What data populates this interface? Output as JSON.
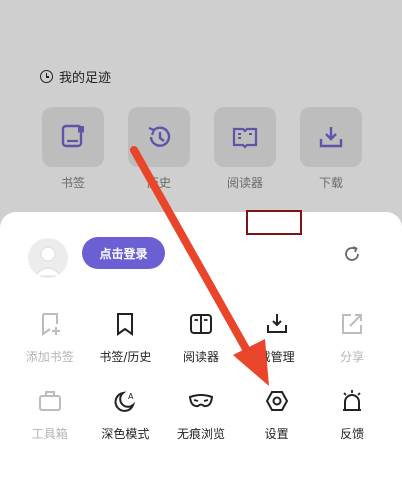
{
  "history_section": {
    "title": "我的足迹",
    "items": [
      {
        "label": "书签",
        "icon": "bookmark-book-icon"
      },
      {
        "label": "历史",
        "icon": "history-clock-icon"
      },
      {
        "label": "阅读器",
        "icon": "reader-book-icon"
      },
      {
        "label": "下载",
        "icon": "download-tray-icon"
      }
    ]
  },
  "sheet": {
    "login_label": "点击登录",
    "row1": [
      {
        "label": "添加书签",
        "icon": "add-bookmark-icon",
        "enabled": false
      },
      {
        "label": "书签/历史",
        "icon": "bookmark-icon",
        "enabled": true
      },
      {
        "label": "阅读器",
        "icon": "reader-icon",
        "enabled": true
      },
      {
        "label": "载管理",
        "icon": "download-manage-icon",
        "enabled": true
      },
      {
        "label": "分享",
        "icon": "share-icon",
        "enabled": false
      }
    ],
    "row2": [
      {
        "label": "工具箱",
        "icon": "toolbox-icon",
        "enabled": false
      },
      {
        "label": "深色模式",
        "icon": "dark-mode-icon",
        "enabled": true
      },
      {
        "label": "无痕浏览",
        "icon": "incognito-mask-icon",
        "enabled": true
      },
      {
        "label": "设置",
        "icon": "settings-hexagon-icon",
        "enabled": true
      },
      {
        "label": "反馈",
        "icon": "feedback-bell-icon",
        "enabled": true
      }
    ]
  },
  "colors": {
    "accent": "#6b5fd3",
    "arrow": "#e8452a",
    "highlight_box": "#7b1515"
  }
}
